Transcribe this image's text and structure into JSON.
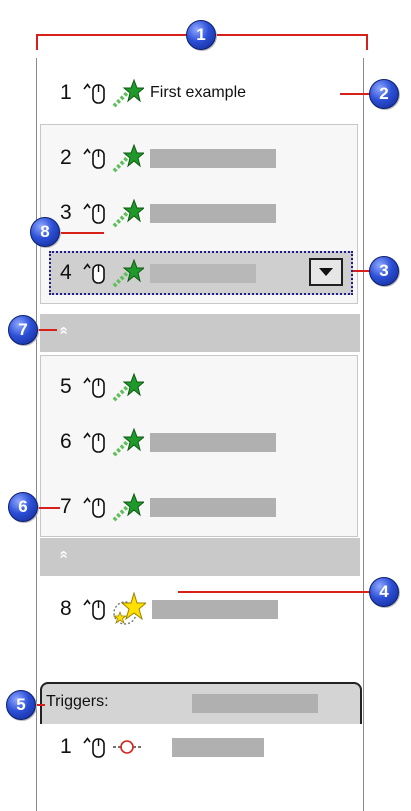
{
  "callouts": [
    "1",
    "2",
    "3",
    "4",
    "5",
    "6",
    "7",
    "8"
  ],
  "first_label": "First example",
  "items": [
    {
      "num": "1"
    },
    {
      "num": "2"
    },
    {
      "num": "3"
    },
    {
      "num": "4"
    },
    {
      "num": "5"
    },
    {
      "num": "6"
    },
    {
      "num": "7"
    },
    {
      "num": "8"
    }
  ],
  "collapse_glyph": "»",
  "triggers_label": "Triggers:",
  "trigger_item": {
    "num": "1"
  },
  "colors": {
    "leader": "#d8201b",
    "callout": "#2c4fd6",
    "star_green": "#1f9a2a",
    "star_yellow": "#ffe000",
    "placeholder_bar": "#b0b0b0"
  },
  "icons": [
    "mouse-click-icon",
    "entrance-effect-star-icon",
    "emphasis-star-icon",
    "trigger-icon",
    "dropdown-arrow-icon",
    "expand-chevron-icon"
  ]
}
